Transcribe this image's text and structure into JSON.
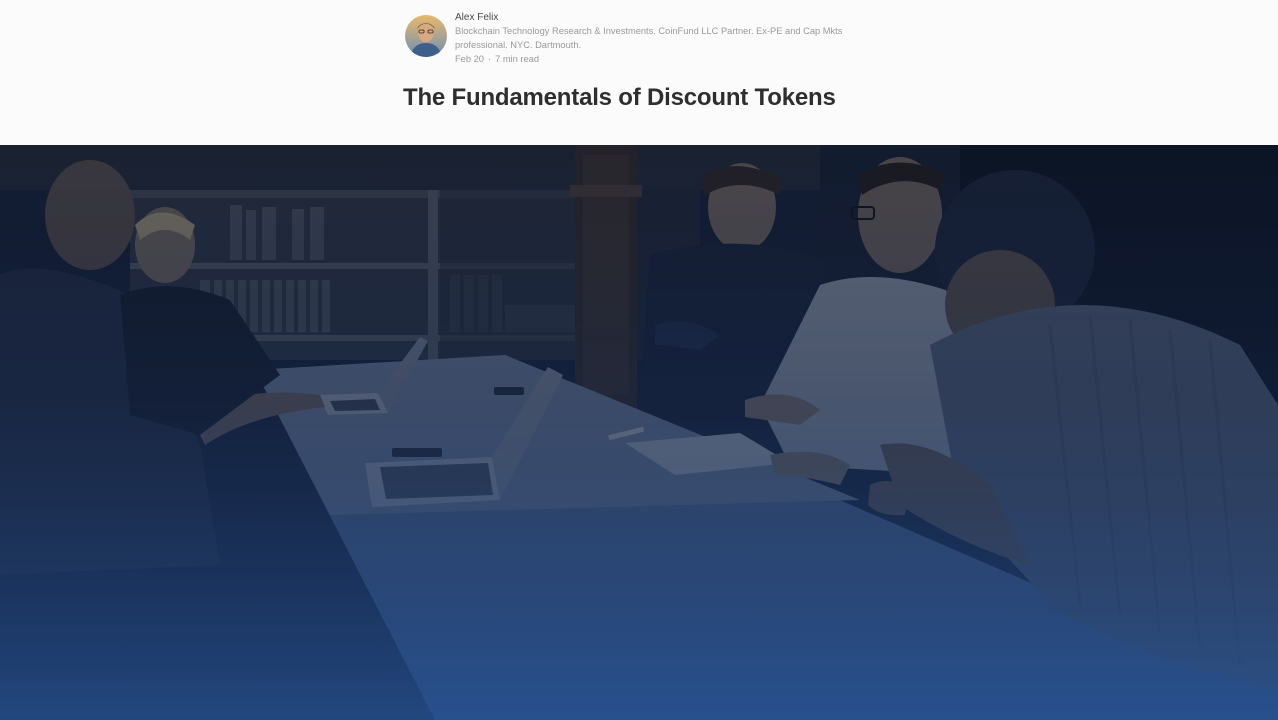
{
  "author": {
    "name": "Alex Felix",
    "bio": "Blockchain Technology Research & Investments. CoinFund LLC Partner. Ex-PE and Cap Mkts professional. NYC. Dartmouth.",
    "date": "Feb 20",
    "separator": "·",
    "read_time": "7 min read"
  },
  "article": {
    "title": "The Fundamentals of Discount Tokens"
  },
  "hero": {
    "icon": "meeting-photo",
    "overlay_color_top": "#0a1020",
    "overlay_color_bottom": "#2d5fa8"
  }
}
